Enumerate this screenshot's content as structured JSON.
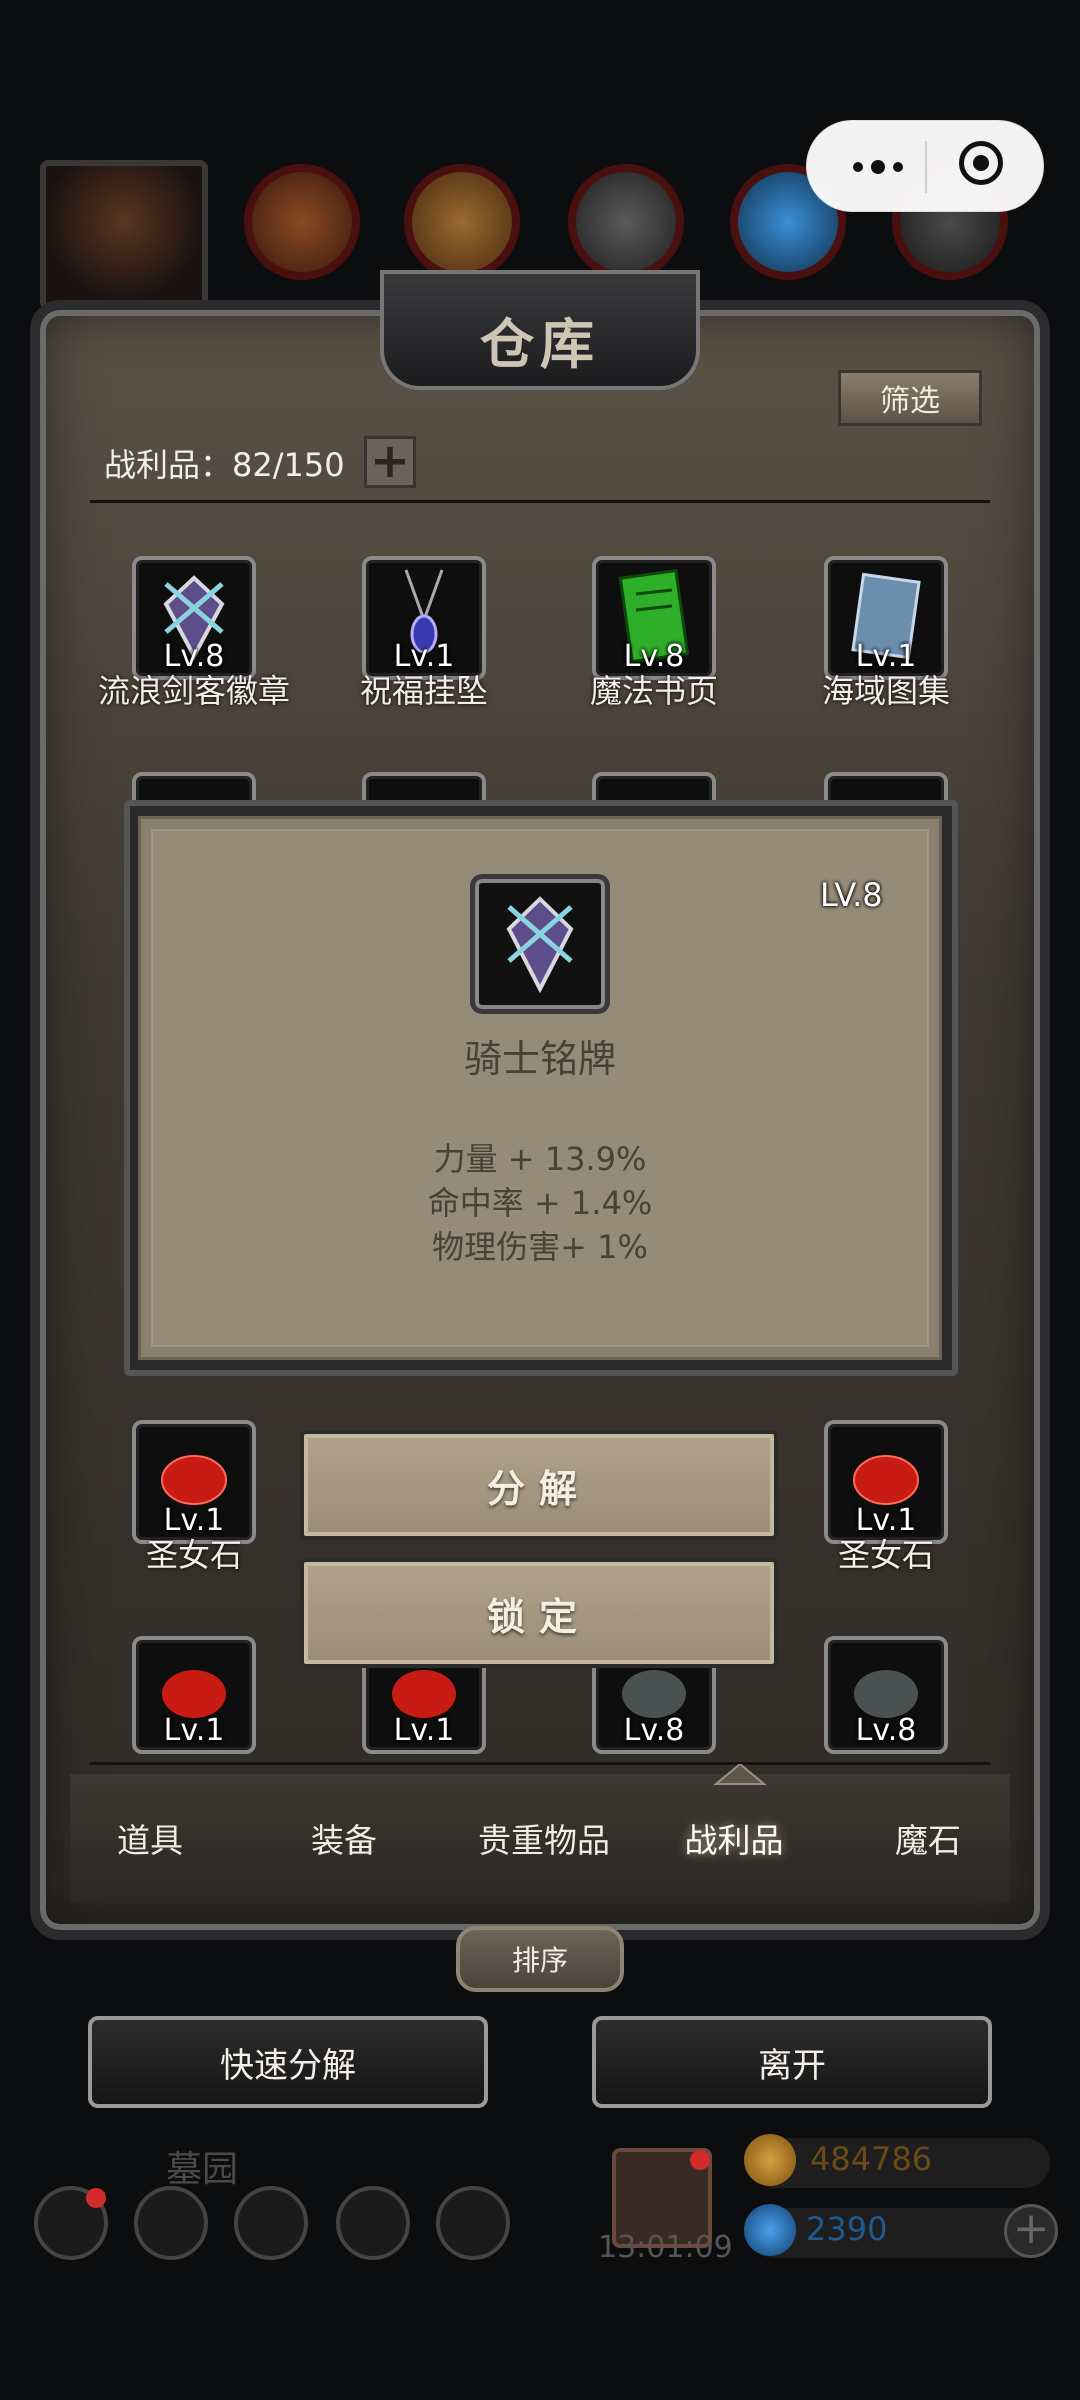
{
  "header": {
    "resource_counts": [
      "",
      "",
      "",
      "",
      ""
    ]
  },
  "panel": {
    "title": "仓库",
    "filter_label": "筛选",
    "spoils_label": "战利品：82/150",
    "plus_label": "+"
  },
  "items_row1": [
    {
      "name": "流浪剑客徽章",
      "lv": "Lv.8",
      "icon": "badge-icon"
    },
    {
      "name": "祝福挂坠",
      "lv": "Lv.1",
      "icon": "pendant-icon"
    },
    {
      "name": "魔法书页",
      "lv": "Lv.8",
      "icon": "spellbook-page-icon"
    },
    {
      "name": "海域图集",
      "lv": "Lv.1",
      "icon": "atlas-icon"
    }
  ],
  "items_row_side": {
    "left_name": "圣女石",
    "left_lv": "Lv.1",
    "right_name": "圣女石",
    "right_lv": "Lv.1"
  },
  "items_row_last": [
    {
      "lv": "Lv.1",
      "color": "#c81b14"
    },
    {
      "lv": "Lv.1",
      "color": "#c81b14"
    },
    {
      "lv": "Lv.8",
      "color": "#4a5252"
    },
    {
      "lv": "Lv.8",
      "color": "#4a5252"
    }
  ],
  "popup": {
    "lv": "LV.8",
    "name": "骑士铭牌",
    "stats": [
      "力量 + 13.9%",
      "命中率 + 1.4%",
      "物理伤害+ 1%"
    ]
  },
  "actions": {
    "decompose": "分解",
    "lock": "锁定"
  },
  "tabs": [
    {
      "label": "道具",
      "active": false
    },
    {
      "label": "装备",
      "active": false
    },
    {
      "label": "贵重物品",
      "active": false
    },
    {
      "label": "战利品",
      "active": true
    },
    {
      "label": "魔石",
      "active": false
    }
  ],
  "sort_label": "排序",
  "bottom": {
    "quick_decompose": "快速分解",
    "leave": "离开"
  },
  "hud": {
    "area_name": "墓园",
    "timer": "13:01:09",
    "gold": "484786",
    "gems": "2390"
  },
  "colors": {
    "gold": "#c8892a",
    "gem": "#3a8fd8"
  }
}
